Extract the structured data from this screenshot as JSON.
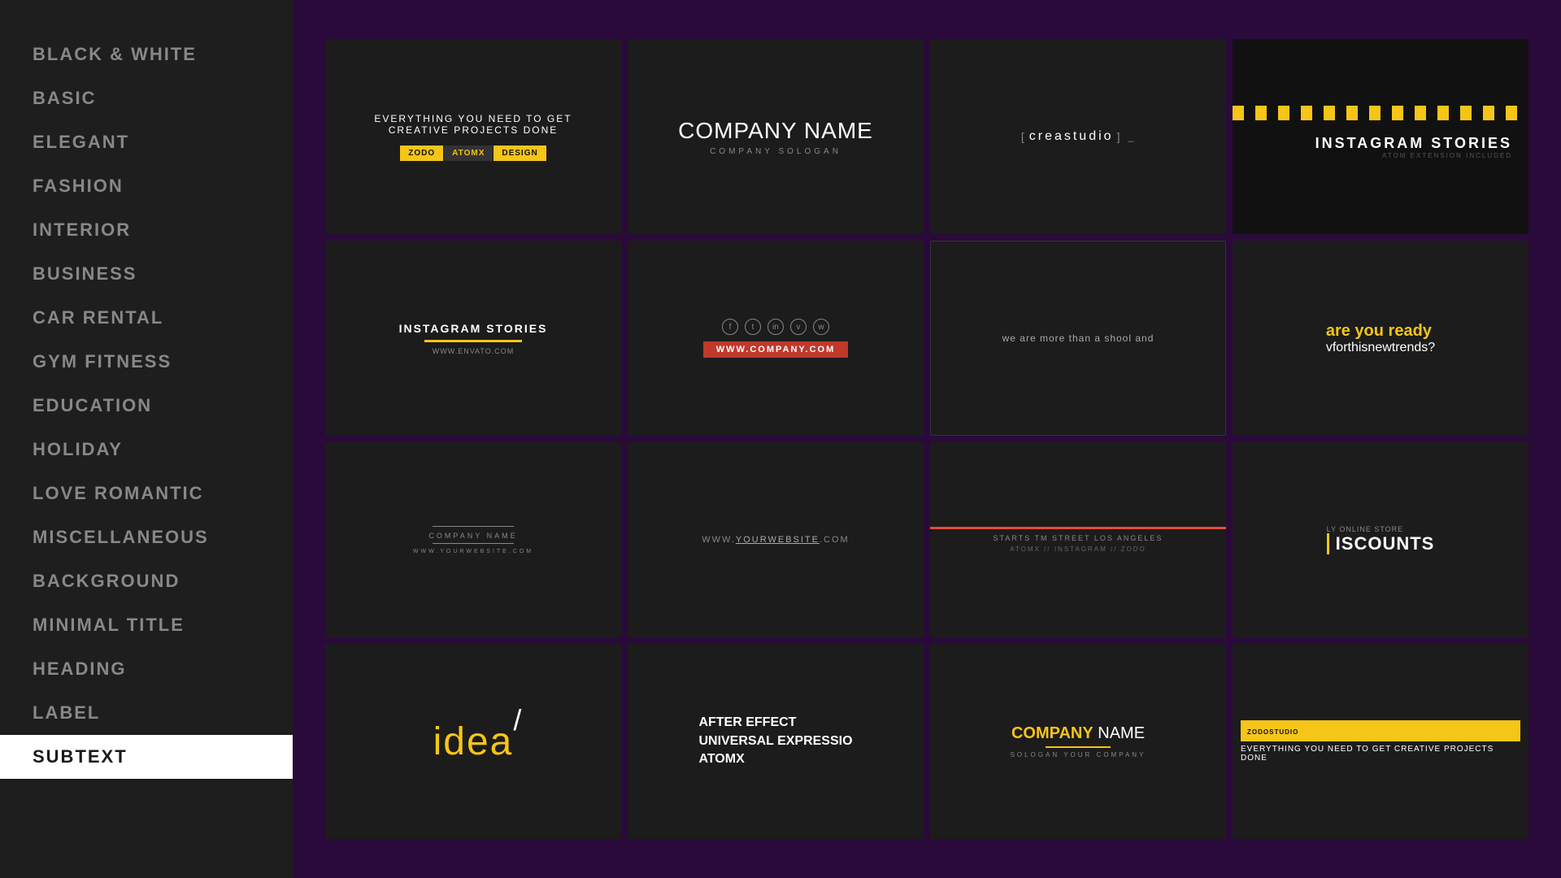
{
  "sidebar": {
    "items": [
      {
        "id": "black-white",
        "label": "BLACK & WHITE"
      },
      {
        "id": "basic",
        "label": "BASIC"
      },
      {
        "id": "elegant",
        "label": "ELEGANT"
      },
      {
        "id": "fashion",
        "label": "FASHION"
      },
      {
        "id": "interior",
        "label": "INTERIOR"
      },
      {
        "id": "business",
        "label": "BUSINESS"
      },
      {
        "id": "car-rental",
        "label": "CAR RENTAL"
      },
      {
        "id": "gym-fitness",
        "label": "GYM FITNESS"
      },
      {
        "id": "education",
        "label": "EDUCATION"
      },
      {
        "id": "holiday",
        "label": "HOLIDAY"
      },
      {
        "id": "love-romantic",
        "label": "LOVE ROMANTIC"
      },
      {
        "id": "miscellaneous",
        "label": "MISCELLANEOUS"
      },
      {
        "id": "background",
        "label": "BACKGROUND"
      },
      {
        "id": "minimal-title",
        "label": "MINIMAL TITLE"
      },
      {
        "id": "heading",
        "label": "HEADING"
      },
      {
        "id": "label",
        "label": "LABEL"
      },
      {
        "id": "subtext",
        "label": "SUBTEXT",
        "active": true
      }
    ]
  },
  "cards": [
    {
      "id": "card-1",
      "top_text": "EVERYTHING YOU NEED TO GET\nCREATIVE PROJECTS DONE",
      "badges": [
        "ZODO",
        "ATOMX",
        "DESIGN"
      ]
    },
    {
      "id": "card-2",
      "company_bold": "COMPANY",
      "company_light": " NAME",
      "slogan": "COMPANY  SOLOGAN"
    },
    {
      "id": "card-3",
      "studio_name": "creastudio"
    },
    {
      "id": "card-4",
      "ig_title": "INSTAGRAM STORIES",
      "ig_sub": "ATOM EXTENSION INCLUDED"
    },
    {
      "id": "card-5",
      "ig2_title": "INSTAGRAM STORIES",
      "ig2_url": "WWW.ENVATO.COM"
    },
    {
      "id": "card-6",
      "website": "WWW.COMPANY.COM"
    },
    {
      "id": "card-7",
      "text": "we are more than a shool and"
    },
    {
      "id": "card-8",
      "ready_text": "are you ready",
      "trends_text": "vforthisnewtrends?"
    },
    {
      "id": "card-9",
      "company_name": "COMPANY NAME",
      "website": "WWW.YOURWEBSITE.COM"
    },
    {
      "id": "card-10",
      "url": "WWW.YOURWEBSITE.COM"
    },
    {
      "id": "card-11",
      "address": "STARTS TM   STREET  LOS ANGELES",
      "handles": "ATOMX  //  INSTAGRAM  //  ZODO"
    },
    {
      "id": "card-12",
      "only_text": "LY ONLINE STORE",
      "discount_text": "ISCOUNTS"
    },
    {
      "id": "card-13",
      "idea_text": "idea",
      "slash": "/"
    },
    {
      "id": "card-14",
      "ae_title": "AFTER EFFECT\nUNIVERSAL EXPRESSIO\nATOMX"
    },
    {
      "id": "card-15",
      "company_name": "COMPANY",
      "name_white": " NAME",
      "sub_text": "SOLOGAN YOUR COMPANY"
    },
    {
      "id": "card-16",
      "brand": "ZODOSTUDIO",
      "everything_text": "EVERYTHING YOU NEED TO GET CREATIVE PROJECTS DONE"
    }
  ]
}
